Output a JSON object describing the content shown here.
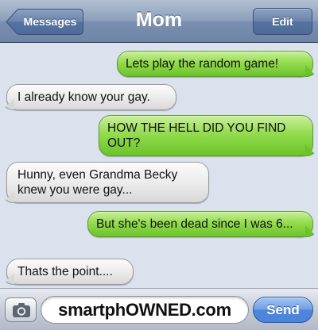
{
  "navbar": {
    "back_label": "Messages",
    "title": "Mom",
    "edit_label": "Edit"
  },
  "messages": [
    {
      "direction": "outgoing",
      "text": "Lets play the random game!"
    },
    {
      "direction": "incoming",
      "text": "I already know your gay."
    },
    {
      "direction": "outgoing",
      "text": "HOW THE HELL DID YOU FIND OUT?"
    },
    {
      "direction": "incoming",
      "text": "Hunny, even Grandma Becky knew you were gay..."
    },
    {
      "direction": "outgoing",
      "text": "But she's been dead since I was 6..."
    },
    {
      "direction": "incoming",
      "text": "Thats the point...."
    }
  ],
  "inputbar": {
    "camera_icon": "camera-icon",
    "field_text": "smartphOWNED.com",
    "send_label": "Send"
  },
  "colors": {
    "outgoing_bubble": "#93dc4e",
    "incoming_bubble": "#ececec",
    "background": "#dbe2ed",
    "send_button": "#4d86db"
  }
}
